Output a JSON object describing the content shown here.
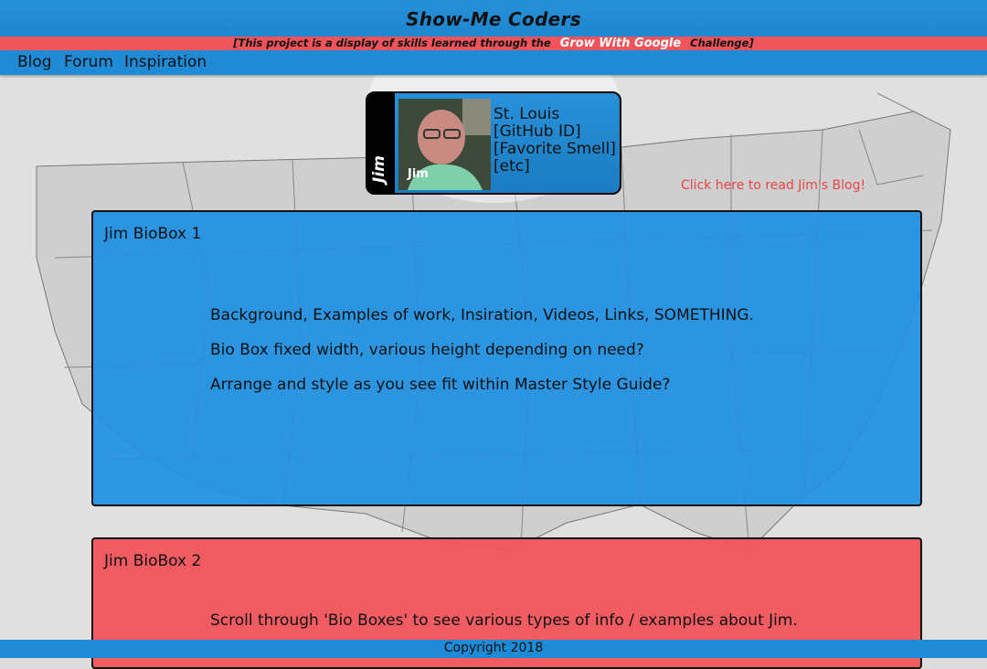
{
  "header": {
    "title": "Show-Me Coders",
    "tagline_prefix": "[This project is a display of skills learned through the",
    "tagline_highlight": "Grow With Google",
    "tagline_suffix": "Challenge]"
  },
  "nav": {
    "items": [
      {
        "label": "Blog"
      },
      {
        "label": "Forum"
      },
      {
        "label": "Inspiration"
      }
    ]
  },
  "profile": {
    "name": "Jim",
    "photo_caption": "Jim",
    "details": [
      "St. Louis",
      "[GitHub ID]",
      "[Favorite Smell]",
      "[etc]"
    ],
    "blog_link": "Click here to read Jim's Blog!"
  },
  "bioboxes": [
    {
      "title": "Jim BioBox 1",
      "lines": [
        "Background, Examples of work, Insiration, Videos, Links, SOMETHING.",
        "Bio Box fixed width, various height depending on need?",
        "Arrange and style as you see fit within Master Style Guide?"
      ]
    },
    {
      "title": "Jim BioBox 2",
      "lines": [
        "Scroll through 'Bio Boxes' to see various types of info / examples about Jim."
      ]
    }
  ],
  "footer": {
    "copyright": "Copyright 2018"
  },
  "colors": {
    "header_blue": "#1f8bd6",
    "accent_red": "#f0545a",
    "biobox_blue": "#1e90e3",
    "biobox_red": "#f0545a",
    "link_red": "#e8454b"
  }
}
